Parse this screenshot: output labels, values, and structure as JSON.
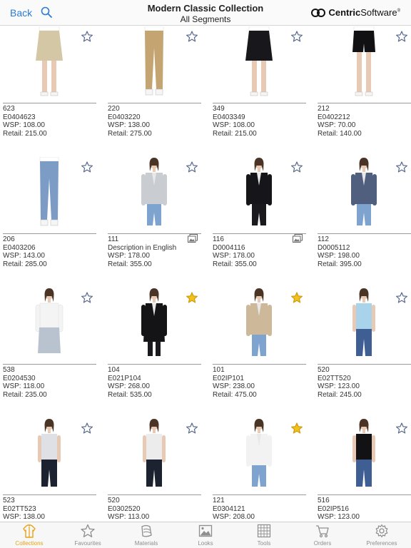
{
  "header": {
    "back_label": "Back",
    "title": "Modern Classic Collection",
    "subtitle": "All Segments",
    "logo_text_a": "Centric",
    "logo_text_b": "Software",
    "logo_mark": "®"
  },
  "colors": {
    "accent": "#2a7bd4",
    "favourite_star": "#f2c21b",
    "tab_active": "#e8a317",
    "tab_inactive": "#8e8e8e"
  },
  "products": [
    {
      "line1": "623",
      "line2": "E0404623",
      "wsp": "WSP: 108.00",
      "retail": "Retail: 215.00",
      "favourite": false,
      "has_photo_icon": false,
      "garment": "skirt",
      "color": "#d4c7a6"
    },
    {
      "line1": "220",
      "line2": "E0403220",
      "wsp": "WSP: 138.00",
      "retail": "Retail: 275.00",
      "favourite": false,
      "has_photo_icon": false,
      "garment": "pants",
      "color": "#c4a571"
    },
    {
      "line1": "349",
      "line2": "E0403349",
      "wsp": "WSP: 108.00",
      "retail": "Retail: 215.00",
      "favourite": false,
      "has_photo_icon": false,
      "garment": "skirt",
      "color": "#17171c"
    },
    {
      "line1": "212",
      "line2": "E0402212",
      "wsp": "WSP: 70.00",
      "retail": "Retail: 140.00",
      "favourite": false,
      "has_photo_icon": false,
      "garment": "shorts",
      "color": "#111114"
    },
    {
      "line1": "206",
      "line2": "E0403206",
      "wsp": "WSP: 143.00",
      "retail": "Retail: 285.00",
      "favourite": false,
      "has_photo_icon": false,
      "garment": "pants",
      "color": "#7c9cc6"
    },
    {
      "line1": "111",
      "line2": "Description in English",
      "wsp": "WSP: 178.00",
      "retail": "Retail: 355.00",
      "favourite": false,
      "has_photo_icon": true,
      "garment": "jacket",
      "color": "#c9ccd1"
    },
    {
      "line1": "116",
      "line2": "D0004116",
      "wsp": "WSP: 178.00",
      "retail": "Retail: 355.00",
      "favourite": false,
      "has_photo_icon": true,
      "garment": "jacket",
      "color": "#16161a"
    },
    {
      "line1": "112",
      "line2": "D0005112",
      "wsp": "WSP: 198.00",
      "retail": "Retail: 395.00",
      "favourite": false,
      "has_photo_icon": false,
      "garment": "jacket",
      "color": "#4f5f7d"
    },
    {
      "line1": "538",
      "line2": "E0204530",
      "wsp": "WSP: 118.00",
      "retail": "Retail: 235.00",
      "favourite": false,
      "has_photo_icon": false,
      "garment": "blouse",
      "color": "#f4f4f4"
    },
    {
      "line1": "104",
      "line2": "E021P104",
      "wsp": "WSP: 268.00",
      "retail": "Retail: 535.00",
      "favourite": true,
      "has_photo_icon": false,
      "garment": "coat",
      "color": "#141416"
    },
    {
      "line1": "101",
      "line2": "E02IP101",
      "wsp": "WSP: 238.00",
      "retail": "Retail: 475.00",
      "favourite": true,
      "has_photo_icon": false,
      "garment": "jacket",
      "color": "#cdb89a"
    },
    {
      "line1": "520",
      "line2": "E02TT520",
      "wsp": "WSP: 123.00",
      "retail": "Retail: 245.00",
      "favourite": false,
      "has_photo_icon": false,
      "garment": "top",
      "color": "#a9d3ea"
    },
    {
      "line1": "523",
      "line2": "E02TT523",
      "wsp": "WSP: 138.00",
      "retail": "",
      "favourite": false,
      "has_photo_icon": false,
      "garment": "top",
      "color": "#dfe0e6"
    },
    {
      "line1": "520",
      "line2": "E0302520",
      "wsp": "WSP: 113.00",
      "retail": "",
      "favourite": false,
      "has_photo_icon": false,
      "garment": "top",
      "color": "#ececec"
    },
    {
      "line1": "121",
      "line2": "E0304121",
      "wsp": "WSP: 208.00",
      "retail": "",
      "favourite": true,
      "has_photo_icon": false,
      "garment": "jacket",
      "color": "#f2f2f2"
    },
    {
      "line1": "516",
      "line2": "E02IP516",
      "wsp": "WSP: 123.00",
      "retail": "",
      "favourite": false,
      "has_photo_icon": false,
      "garment": "top",
      "color": "#121214"
    }
  ],
  "tabs": [
    {
      "label": "Collections",
      "icon": "collections-icon",
      "active": true
    },
    {
      "label": "Favourites",
      "icon": "favourites-star-icon",
      "active": false
    },
    {
      "label": "Materials",
      "icon": "materials-icon",
      "active": false
    },
    {
      "label": "Looks",
      "icon": "looks-icon",
      "active": false
    },
    {
      "label": "Tools",
      "icon": "tools-grid-icon",
      "active": false
    },
    {
      "label": "Orders",
      "icon": "orders-cart-icon",
      "active": false
    },
    {
      "label": "Preferences",
      "icon": "preferences-gear-icon",
      "active": false
    }
  ]
}
